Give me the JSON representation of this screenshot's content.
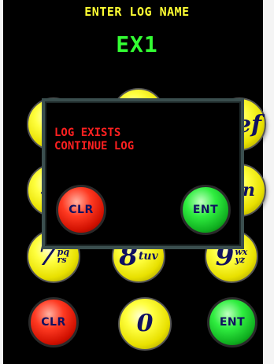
{
  "header": {
    "title": "ENTER LOG NAME"
  },
  "entry": {
    "value": "EX1"
  },
  "keypad": {
    "row1": [
      {
        "partial": ""
      },
      {
        "partial": ""
      },
      {
        "partial": "ef"
      }
    ],
    "row2": [
      {
        "partial": "4"
      },
      {
        "partial": "n"
      }
    ],
    "row3": [
      {
        "digit": "7",
        "letters_top": "pq",
        "letters_bottom": "rs"
      },
      {
        "digit": "8",
        "letters": "tuv"
      },
      {
        "digit": "9",
        "letters_top": "wx",
        "letters_bottom": "yz"
      }
    ],
    "row4": {
      "clear": "CLR",
      "zero": "0",
      "enter": "ENT"
    }
  },
  "dialog": {
    "line1": "LOG EXISTS",
    "line2": "CONTINUE LOG",
    "clear": "CLR",
    "enter": "ENT"
  },
  "colors": {
    "header": "#ffff33",
    "entry": "#33ff33",
    "message": "#ff2020",
    "dialog_border": "#3a4e4e"
  }
}
